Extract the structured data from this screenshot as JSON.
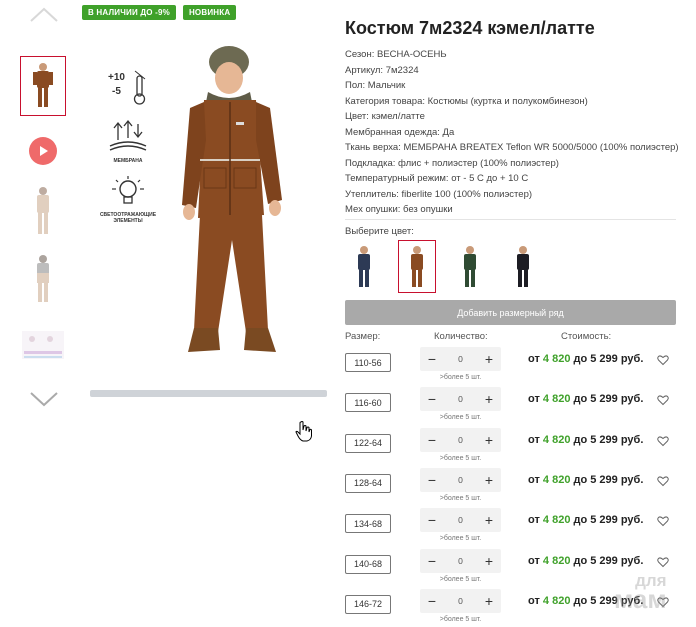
{
  "badges": [
    "В НАЛИЧИИ ДО -9%",
    "НОВИНКА"
  ],
  "features": [
    {
      "icon": "temperature-icon",
      "label": ""
    },
    {
      "icon": "membrane-icon",
      "label": "МЕМБРАНА"
    },
    {
      "icon": "reflective-bulb-icon",
      "label": "СВЕТООТРАЖАЮЩИЕ ЭЛЕМЕНТЫ"
    }
  ],
  "temperature": {
    "top": "+10",
    "bottom": "-5"
  },
  "product": {
    "title": "Костюм 7м2324 кэмел/латте",
    "specs": [
      "Сезон: ВЕСНА-ОСЕНЬ",
      "Артикул: 7м2324",
      "Пол: Мальчик",
      "Категория товара: Костюмы (куртка и полукомбинезон)",
      "Цвет: кэмел/латте",
      "Мембранная одежда: Да",
      "Ткань верха: МЕМБРАНА BREATEX Teflon WR 5000/5000 (100% полиэстер)",
      "Подкладка: флис + полиэстер (100% полиэстер)",
      "Температурный режим: от - 5 С до + 10 С",
      "Утеплитель: fiberlite 100 (100% полиэстер)",
      "Мех опушки: без опушки"
    ]
  },
  "color_label": "Выберите цвет:",
  "swatch_colors": [
    "#2d3a55",
    "#8a4b22",
    "#2f4b33",
    "#1d1d24"
  ],
  "add_row_label": "Добавить размерный ряд",
  "headers": {
    "size": "Размер:",
    "qty": "Количество:",
    "cost": "Стоимость:"
  },
  "rows": [
    {
      "size": "110-56",
      "qty": "0",
      "avail": ">более 5 шт.",
      "from": "от",
      "price_from": "4 820",
      "to": "до 5 299 руб."
    },
    {
      "size": "116-60",
      "qty": "0",
      "avail": ">более 5 шт.",
      "from": "от",
      "price_from": "4 820",
      "to": "до 5 299 руб."
    },
    {
      "size": "122-64",
      "qty": "0",
      "avail": ">более 5 шт.",
      "from": "от",
      "price_from": "4 820",
      "to": "до 5 299 руб."
    },
    {
      "size": "128-64",
      "qty": "0",
      "avail": ">более 5 шт.",
      "from": "от",
      "price_from": "4 820",
      "to": "до 5 299 руб."
    },
    {
      "size": "134-68",
      "qty": "0",
      "avail": ">более 5 шт.",
      "from": "от",
      "price_from": "4 820",
      "to": "до 5 299 руб."
    },
    {
      "size": "140-68",
      "qty": "0",
      "avail": ">более 5 шт.",
      "from": "от",
      "price_from": "4 820",
      "to": "до 5 299 руб."
    },
    {
      "size": "146-72",
      "qty": "0",
      "avail": ">более 5 шт.",
      "from": "от",
      "price_from": "4 820",
      "to": "до 5 299 руб."
    }
  ],
  "stepper": {
    "minus": "−",
    "plus": "+"
  },
  "watermark": {
    "line1": "для",
    "line2": "мам"
  },
  "colors": {
    "accent": "#3fa12a",
    "active_border": "#c8102e",
    "product_brown": "#8a4b22"
  }
}
